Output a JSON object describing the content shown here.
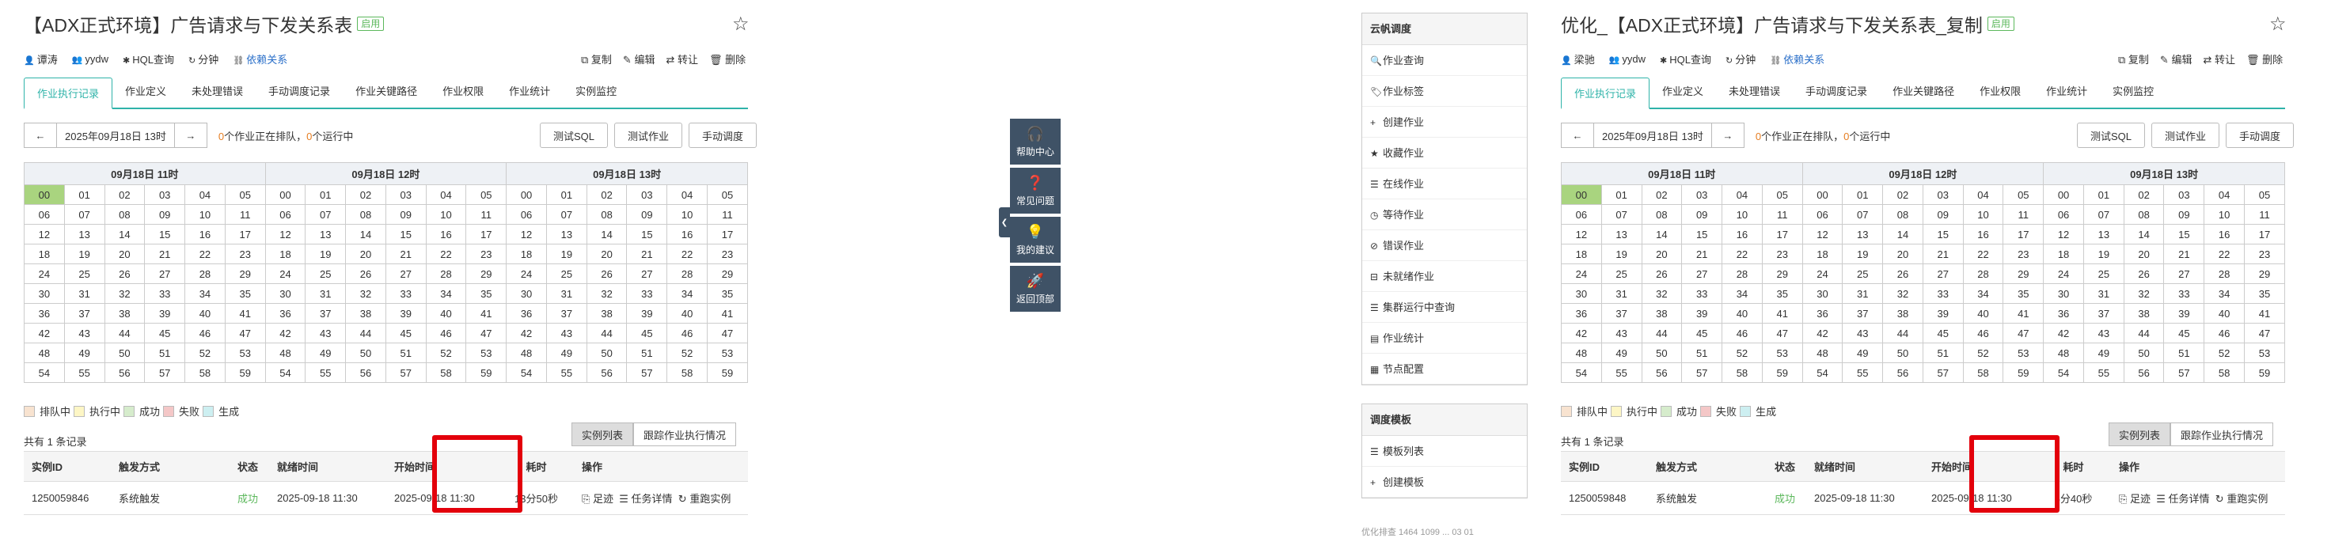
{
  "left": {
    "title": "【ADX正式环境】广告请求与下发关系表",
    "badge": "启用",
    "meta": {
      "owner": "谭涛",
      "group": "yydw",
      "hql": "HQL查询",
      "partition": "分钟",
      "deps": "依赖关系"
    },
    "actions": {
      "copy": "复制",
      "edit": "编辑",
      "transfer": "转让",
      "delete": "删除"
    },
    "tabs": [
      "作业执行记录",
      "作业定义",
      "未处理错误",
      "手动调度记录",
      "作业关键路径",
      "作业权限",
      "作业统计",
      "实例监控"
    ],
    "nav": {
      "prev": "←",
      "date": "2025年09月18日 13时",
      "next": "→",
      "running_pre": "个作业正在排队，",
      "queued": "0",
      "running": "0",
      "running_post": "个运行中"
    },
    "buttons": [
      "测试SQL",
      "测试作业",
      "手动调度"
    ],
    "hours": [
      "09月18日 11时",
      "09月18日 12时",
      "09月18日 13时"
    ],
    "legend": [
      "排队中",
      "执行中",
      "成功",
      "失败",
      "生成"
    ],
    "toggle": [
      "实例列表",
      "跟踪作业执行情况"
    ],
    "count": "共有 1 条记录",
    "headers": [
      "实例ID",
      "触发方式",
      "状态",
      "就绪时间",
      "开始时间",
      "耗时",
      "操作"
    ],
    "row": {
      "id": "1250059846",
      "trigger": "系统触发",
      "status": "成功",
      "ready": "2025-09-18 11:30",
      "start": "2025-09-18 11:30",
      "duration": "13分50秒",
      "ops": [
        "足迹",
        "任务详情",
        "重跑实例"
      ]
    }
  },
  "right": {
    "title": "优化_【ADX正式环境】广告请求与下发关系表_复制",
    "badge": "启用",
    "meta": {
      "owner": "梁驰",
      "group": "yydw",
      "hql": "HQL查询",
      "partition": "分钟",
      "deps": "依赖关系"
    },
    "actions": {
      "copy": "复制",
      "edit": "编辑",
      "transfer": "转让",
      "delete": "删除"
    },
    "tabs": [
      "作业执行记录",
      "作业定义",
      "未处理错误",
      "手动调度记录",
      "作业关键路径",
      "作业权限",
      "作业统计",
      "实例监控"
    ],
    "nav": {
      "prev": "←",
      "date": "2025年09月18日 13时",
      "next": "→",
      "running_pre": "个作业正在排队，",
      "queued": "0",
      "running": "0",
      "running_post": "个运行中"
    },
    "buttons": [
      "测试SQL",
      "测试作业",
      "手动调度"
    ],
    "hours": [
      "09月18日 11时",
      "09月18日 12时",
      "09月18日 13时"
    ],
    "legend": [
      "排队中",
      "执行中",
      "成功",
      "失败",
      "生成"
    ],
    "toggle": [
      "实例列表",
      "跟踪作业执行情况"
    ],
    "count": "共有 1 条记录",
    "headers": [
      "实例ID",
      "触发方式",
      "状态",
      "就绪时间",
      "开始时间",
      "耗时",
      "操作"
    ],
    "row": {
      "id": "1250059848",
      "trigger": "系统触发",
      "status": "成功",
      "ready": "2025-09-18 11:30",
      "start": "2025-09-18 11:30",
      "duration": "6分40秒",
      "ops": [
        "足迹",
        "任务详情",
        "重跑实例"
      ]
    }
  },
  "float": [
    "帮助中心",
    "常见问题",
    "我的建议",
    "返回顶部"
  ],
  "sidebar": {
    "group1": "云帆调度",
    "items1": [
      {
        "icon": "search-icon",
        "label": "作业查询"
      },
      {
        "icon": "tag-icon",
        "label": "作业标签"
      },
      {
        "icon": "plus-icon",
        "label": "创建作业"
      },
      {
        "icon": "star-icon",
        "label": "收藏作业"
      },
      {
        "icon": "list-icon",
        "label": "在线作业"
      },
      {
        "icon": "clock-icon",
        "label": "等待作业"
      },
      {
        "icon": "error-icon",
        "label": "错误作业"
      },
      {
        "icon": "minus-icon",
        "label": "未就绪作业"
      },
      {
        "icon": "list-icon",
        "label": "集群运行中查询"
      },
      {
        "icon": "chart-icon",
        "label": "作业统计"
      },
      {
        "icon": "grid-icon",
        "label": "节点配置"
      }
    ],
    "group2": "调度模板",
    "items2": [
      {
        "icon": "list-icon",
        "label": "模板列表"
      },
      {
        "icon": "plus-icon",
        "label": "创建模板"
      }
    ]
  },
  "footer_hint": "优化排查 1464 1099 ... 03 01"
}
